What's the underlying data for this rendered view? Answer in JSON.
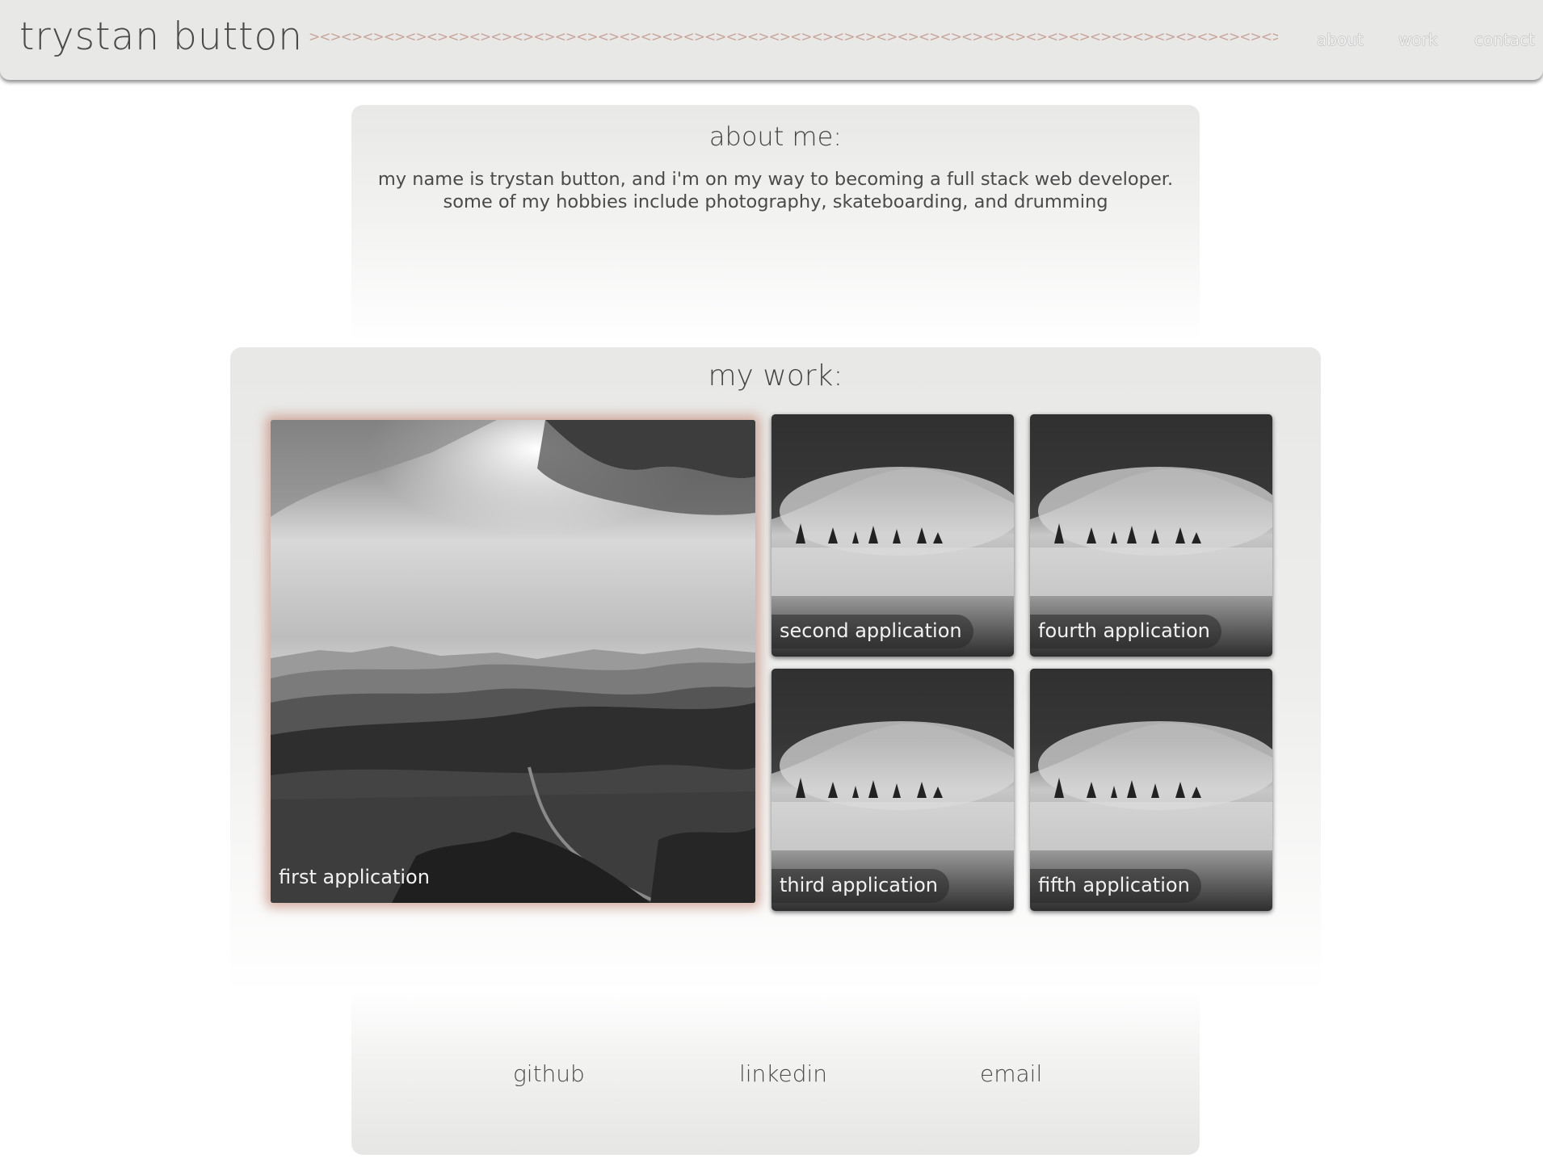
{
  "header": {
    "brand": "trystan button",
    "divider": "><><><><><><><><><><><><><><><><><><><><><><><><><><><><><><><><><><><><><><><><><><><><><><><><><><><",
    "nav": {
      "about": "about",
      "work": "work",
      "contact": "contact"
    }
  },
  "about": {
    "title": "about me:",
    "line1": "my name is trystan button, and i'm on my way to becoming a full stack web developer.",
    "line2": "some of my hobbies include photography, skateboarding, and drumming"
  },
  "work": {
    "title": "my work:",
    "apps": [
      {
        "label": "first application",
        "image": "mountain-landscape-photo"
      },
      {
        "label": "second application",
        "image": "misty-forest-photo"
      },
      {
        "label": "fourth application",
        "image": "misty-forest-photo"
      },
      {
        "label": "third application",
        "image": "misty-forest-photo"
      },
      {
        "label": "fifth application",
        "image": "misty-forest-photo"
      }
    ]
  },
  "contact": {
    "github": "github",
    "linkedin": "linkedin",
    "email": "email"
  },
  "colors": {
    "panel": "#e8e8e6",
    "accent_glow": "#c8968a",
    "divider": "#c9a49a",
    "text": "#4a4a4a"
  }
}
